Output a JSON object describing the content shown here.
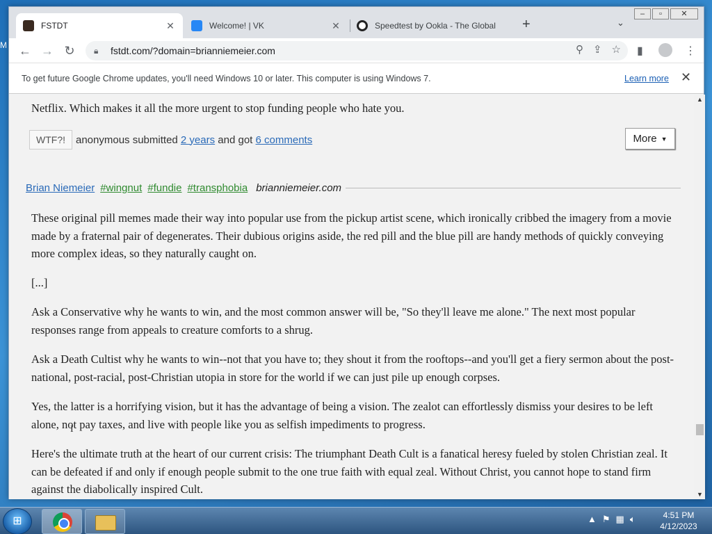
{
  "browser": {
    "tabs": [
      {
        "title": "FSTDT",
        "active": true
      },
      {
        "title": "Welcome! | VK",
        "active": false
      },
      {
        "title": "Speedtest by Ookla - The Global",
        "active": false
      }
    ],
    "url": "fstdt.com/?domain=brianniemeier.com",
    "infobar": {
      "message": "To get future Google Chrome updates, you'll need Windows 10 or later. This computer is using Windows 7.",
      "learn_more": "Learn more"
    }
  },
  "page": {
    "prev_post_tail": "Netflix. Which makes it all the more urgent to stop funding people who hate you.",
    "prev_post_footer": {
      "wtf_label": "WTF?!",
      "submitter_text": "anonymous submitted",
      "time_link": "2 years",
      "middle_text": "and got",
      "comments_link": "6 comments",
      "more_label": "More"
    },
    "post": {
      "author": "Brian Niemeier",
      "tags": [
        "#wingnut",
        "#fundie",
        "#transphobia"
      ],
      "domain": "brianniemeier.com",
      "paragraphs": [
        "These original pill memes made their way into popular use from the pickup artist scene, which ironically cribbed the imagery from a movie made by a fraternal pair of degenerates. Their dubious origins aside, the red pill and the blue pill are handy methods of quickly conveying more complex ideas, so they naturally caught on.",
        "[...]",
        "Ask a Conservative why he wants to win, and the most common answer will be, \"So they'll leave me alone.\" The next most popular responses range from appeals to creature comforts to a shrug.",
        "Ask a Death Cultist why he wants to win--not that you have to; they shout it from the rooftops--and you'll get a fiery sermon about the post-national, post-racial, post-Christian utopia in store for the world if we can just pile up enough corpses.",
        "Yes, the latter is a horrifying vision, but it has the advantage of being a vision. The zealot can effortlessly dismiss your desires to be left alone, not pay taxes, and live with people like you as selfish impediments to progress.",
        "Here's the ultimate truth at the heart of our current crisis: The triumphant Death Cult is a fanatical heresy fueled by stolen Christian zeal. It can be defeated if and only if enough people submit to the one true faith with equal zeal. Without Christ, you cannot hope to stand firm against the diabolically inspired Cult."
      ]
    }
  },
  "taskbar": {
    "time": "4:51 PM",
    "date": "4/12/2023"
  },
  "desktop_fragment": "M"
}
